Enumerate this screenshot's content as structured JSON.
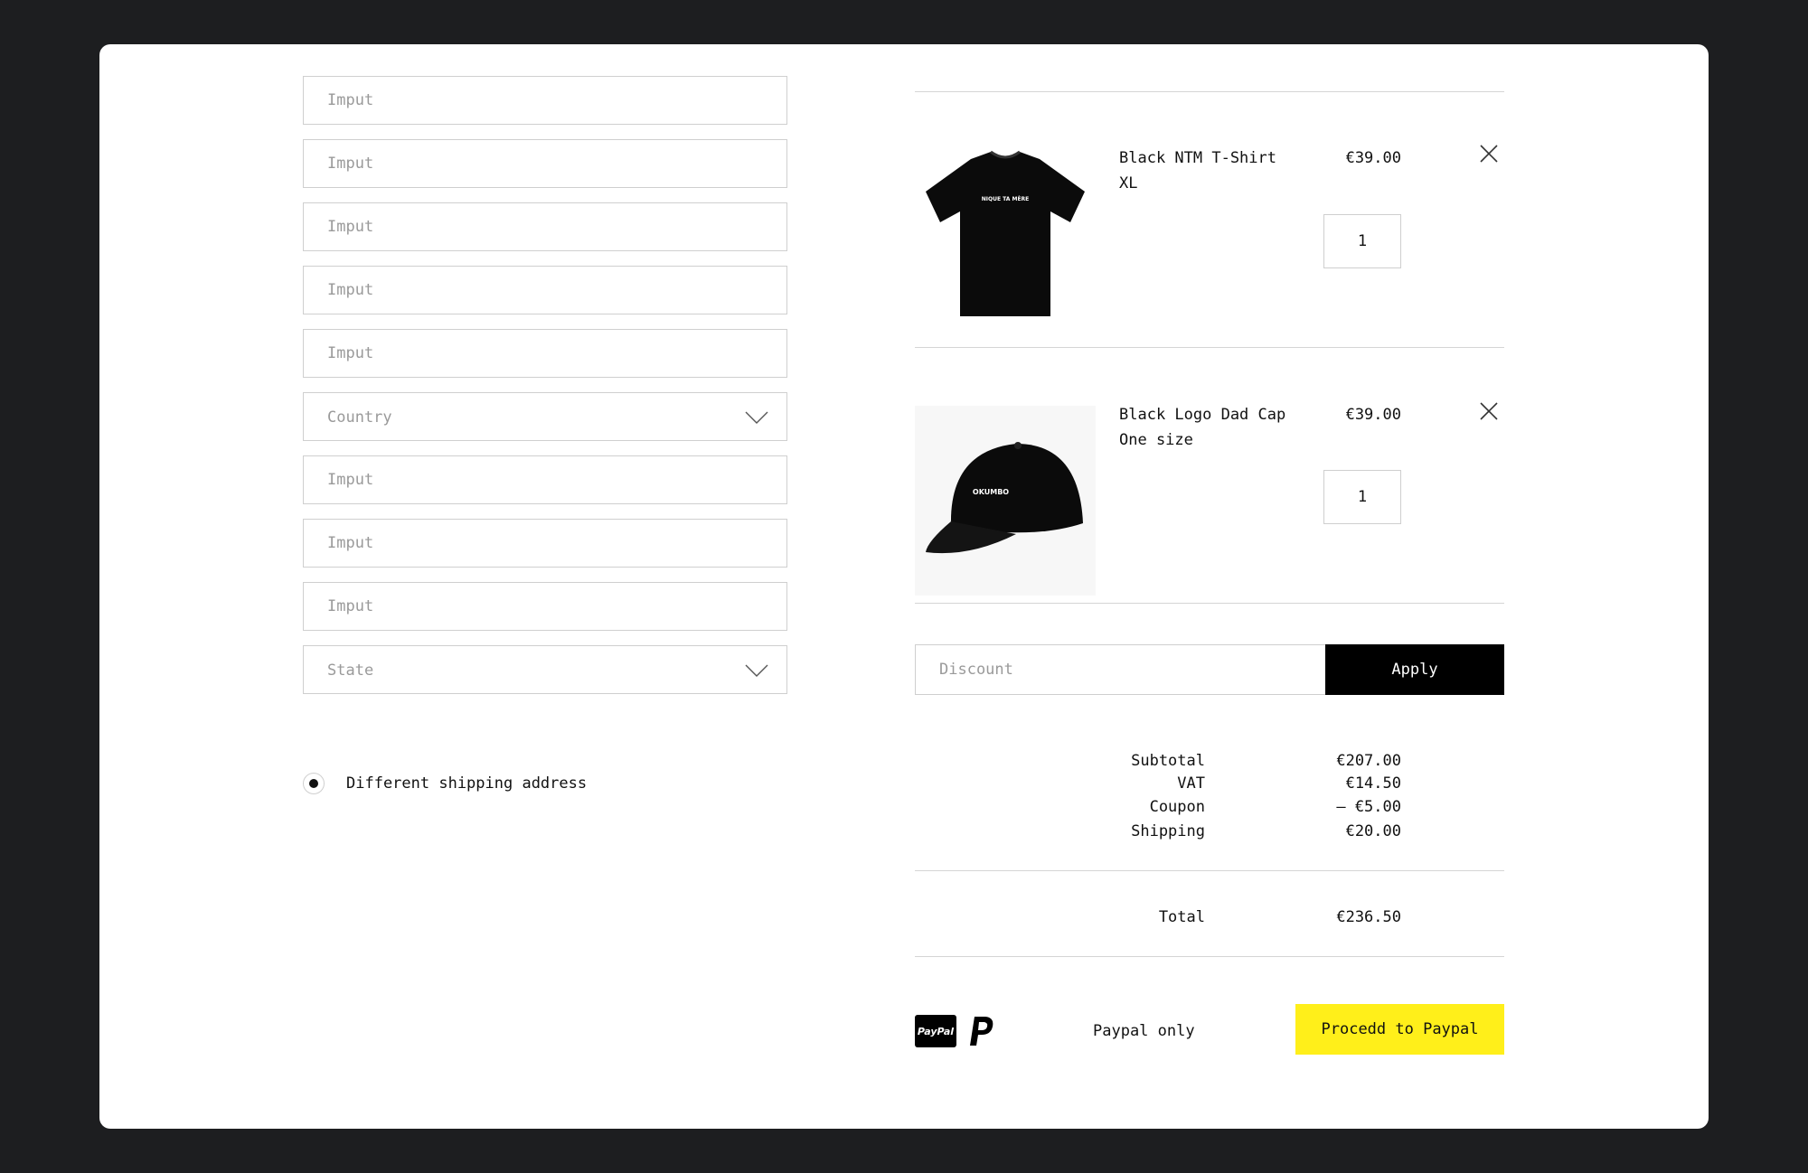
{
  "form": {
    "fields": [
      {
        "placeholder": "Imput"
      },
      {
        "placeholder": "Imput"
      },
      {
        "placeholder": "Imput"
      },
      {
        "placeholder": "Imput"
      },
      {
        "placeholder": "Imput"
      },
      {
        "label": "Country"
      },
      {
        "placeholder": "Imput"
      },
      {
        "placeholder": "Imput"
      },
      {
        "placeholder": "Imput"
      },
      {
        "label": "State"
      }
    ],
    "shipping_option": {
      "label": "Different shipping address",
      "checked": true
    }
  },
  "cart": {
    "items": [
      {
        "name": "Black NTM T-Shirt",
        "variant": "XL",
        "price": "€39.00",
        "quantity": "1",
        "print": "NIQUE TA MÈRE",
        "icon": "tshirt-image"
      },
      {
        "name": "Black Logo Dad Cap",
        "variant": "One size",
        "price": "€39.00",
        "quantity": "1",
        "print": "OKUMBO",
        "icon": "cap-image"
      }
    ],
    "discount": {
      "placeholder": "Discount",
      "apply_label": "Apply"
    },
    "summary": {
      "rows": [
        {
          "label": "Subtotal",
          "value": "€207.00"
        },
        {
          "label": "VAT",
          "value": "€14.50"
        },
        {
          "label": "Coupon",
          "value": "– €5.00"
        },
        {
          "label": "Shipping",
          "value": "€20.00"
        }
      ],
      "total": {
        "label": "Total",
        "value": "€236.50"
      }
    },
    "payment": {
      "badge_text": "PayPal",
      "note": "Paypal only",
      "button_label": "Procedd to Paypal"
    }
  },
  "colors": {
    "background": "#1d1e20",
    "card": "#ffffff",
    "accent": "#ffef1a",
    "apply_button": "#000000"
  }
}
